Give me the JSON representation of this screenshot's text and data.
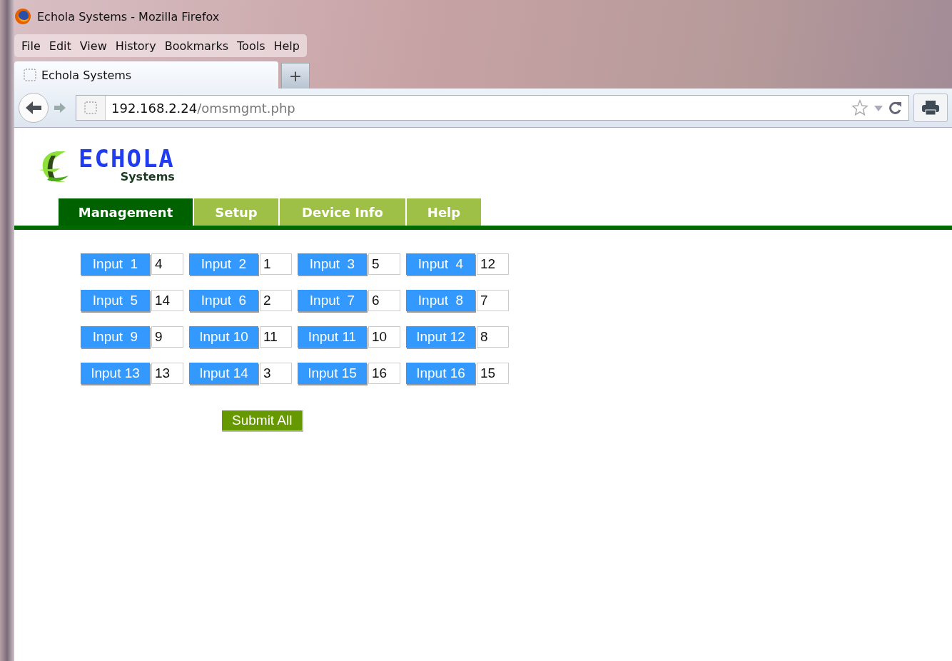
{
  "window": {
    "title": "Echola Systems - Mozilla Firefox"
  },
  "menu": [
    "File",
    "Edit",
    "View",
    "History",
    "Bookmarks",
    "Tools",
    "Help"
  ],
  "browser_tab": {
    "title": "Echola Systems",
    "new_tab": "+"
  },
  "address": {
    "host": "192.168.2.24",
    "path": "/omsmgmt.php"
  },
  "logo": {
    "name": "ECHOLA",
    "subtitle": "Systems"
  },
  "tabs": [
    {
      "label": "Management",
      "selected": true
    },
    {
      "label": "Setup",
      "selected": false
    },
    {
      "label": "Device Info",
      "selected": false
    },
    {
      "label": "Help",
      "selected": false
    }
  ],
  "inputs": [
    {
      "label": "Input  1",
      "value": "4"
    },
    {
      "label": "Input  2",
      "value": "1"
    },
    {
      "label": "Input  3",
      "value": "5"
    },
    {
      "label": "Input  4",
      "value": "12"
    },
    {
      "label": "Input  5",
      "value": "14"
    },
    {
      "label": "Input  6",
      "value": "2"
    },
    {
      "label": "Input  7",
      "value": "6"
    },
    {
      "label": "Input  8",
      "value": "7"
    },
    {
      "label": "Input  9",
      "value": "9"
    },
    {
      "label": "Input 10",
      "value": "11"
    },
    {
      "label": "Input 11",
      "value": "10"
    },
    {
      "label": "Input 12",
      "value": "8"
    },
    {
      "label": "Input 13",
      "value": "13"
    },
    {
      "label": "Input 14",
      "value": "3"
    },
    {
      "label": "Input 15",
      "value": "16"
    },
    {
      "label": "Input 16",
      "value": "15"
    }
  ],
  "submit": "Submit All"
}
